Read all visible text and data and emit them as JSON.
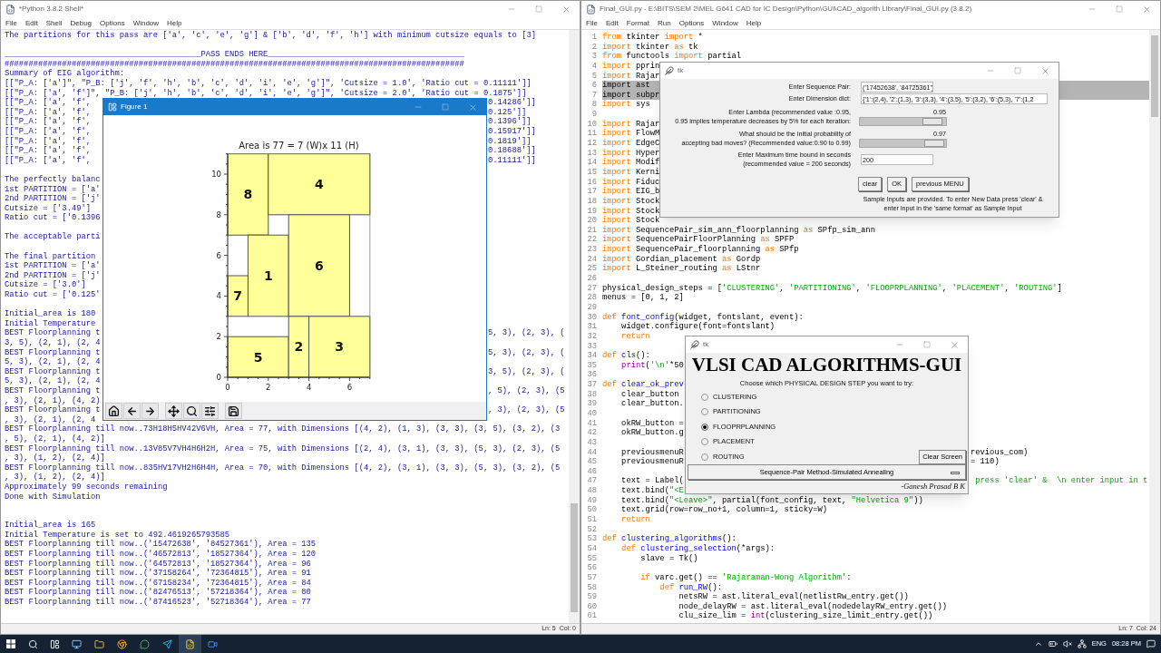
{
  "shell": {
    "title": "*Python 3.8.2 Shell*",
    "menu": [
      "File",
      "Edit",
      "Shell",
      "Debug",
      "Options",
      "Window",
      "Help"
    ],
    "lines": [
      {
        "kind": "text",
        "text": "The partitions for this pass are ['a', 'c', 'e', 'g'] & ['b', 'd', 'f', 'h'] with minimum cutsize equals to [3]"
      },
      {
        "kind": "blank"
      },
      {
        "kind": "text",
        "text": "_________________________________________PASS ENDS HERE_________________________________________"
      },
      {
        "kind": "text",
        "text": "################################################################################################"
      },
      {
        "kind": "text",
        "text": "Summary of EIG algorithm:"
      },
      {
        "kind": "text",
        "text": "[[\"P_A: ['a']\", \"P_B: ['j', 'f', 'h', 'b', 'c', 'd', 'i', 'e', 'g']\", 'Cutsize = 1.0', 'Ratio cut = 0.11111']]"
      },
      {
        "kind": "text",
        "text": "[[\"P_A: ['a', 'f']\", \"P_B: ['j', 'h', 'b', 'c', 'd', 'i', 'e', 'g']\", 'Cutsize = 2.0', 'Ratio cut = 0.1875']]"
      },
      {
        "kind": "split",
        "left": "[[\"P_A: ['a', 'f', ",
        "right": "0.14286']]"
      },
      {
        "kind": "split",
        "left": "[[\"P_A: ['a', 'f', ",
        "right": "0.125']]"
      },
      {
        "kind": "split",
        "left": "[[\"P_A: ['a', 'f', ",
        "right": "0.1396']]"
      },
      {
        "kind": "split",
        "left": "[[\"P_A: ['a', 'f', ",
        "right": "0.15917']]"
      },
      {
        "kind": "split",
        "left": "[[\"P_A: ['a', 'f', ",
        "right": "0.1819']]"
      },
      {
        "kind": "split",
        "left": "[[\"P_A: ['a', 'f', ",
        "right": "0.18688']]"
      },
      {
        "kind": "split",
        "left": "[[\"P_A: ['a', 'f', ",
        "right": "0.11111']]"
      },
      {
        "kind": "blank"
      },
      {
        "kind": "text",
        "text": "The perfectly balanc"
      },
      {
        "kind": "text",
        "text": "1st PARTITION = ['a'"
      },
      {
        "kind": "text",
        "text": "2nd PARTITION = ['j'"
      },
      {
        "kind": "text",
        "text": "Cutsize = ['3.49']"
      },
      {
        "kind": "text",
        "text": "Ratio cut = ['0.1396"
      },
      {
        "kind": "blank"
      },
      {
        "kind": "text",
        "text": "The acceptable parti"
      },
      {
        "kind": "blank"
      },
      {
        "kind": "text",
        "text": "The final partition"
      },
      {
        "kind": "text",
        "text": "1st PARTITION = ['a'"
      },
      {
        "kind": "text",
        "text": "2nd PARTITION = ['j'"
      },
      {
        "kind": "text",
        "text": "Cutsize = ['3.0']"
      },
      {
        "kind": "text",
        "text": "Ratio cut = ['0.125'"
      },
      {
        "kind": "blank"
      },
      {
        "kind": "text",
        "text": "Initial_area is 180"
      },
      {
        "kind": "text",
        "text": "Initial Temperature"
      },
      {
        "kind": "split",
        "left": "BEST Floorplanning t",
        "right": "5, 3), (2, 3), ("
      },
      {
        "kind": "text",
        "text": "3, 5), (2, 1), (2, 4"
      },
      {
        "kind": "split",
        "left": "BEST Floorplanning t",
        "right": "5, 3), (2, 3), ("
      },
      {
        "kind": "text",
        "text": "5, 3), (2, 1), (2, 4"
      },
      {
        "kind": "split",
        "left": "BEST Floorplanning t",
        "right": "3, 5), (2, 3), ("
      },
      {
        "kind": "text",
        "text": "5, 3), (2, 1), (2, 4"
      },
      {
        "kind": "split",
        "left": "BEST Floorplanning t",
        "right": ", 5), (2, 3), (5"
      },
      {
        "kind": "text",
        "text": ", 3), (2, 1), (4, 2)"
      },
      {
        "kind": "split",
        "left": "BEST Floorplanning t",
        "right": ", 3), (2, 3), (5"
      },
      {
        "kind": "text",
        "text": ", 3), (2, 1), (2, 4"
      },
      {
        "kind": "text",
        "text": "BEST Floorplanning till now..73H18H5HV42V6VH, Area = 77, with Dimensions [(4, 2), (1, 3), (3, 3), (3, 5), (3, 2), (3"
      },
      {
        "kind": "text",
        "text": ", 5), (2, 1), (4, 2)]"
      },
      {
        "kind": "text",
        "text": "BEST Floorplanning till now..13V85V7VH4H6H2H, Area = 75, with Dimensions [(2, 4), (3, 1), (3, 3), (5, 3), (2, 3), (5"
      },
      {
        "kind": "text",
        "text": ", 3), (1, 2), (2, 4)]"
      },
      {
        "kind": "text",
        "text": "BEST Floorplanning till now..835HV17VH2H6H4H, Area = 70, with Dimensions [(4, 2), (3, 1), (3, 3), (5, 3), (3, 2), (5"
      },
      {
        "kind": "text",
        "text": ", 3), (1, 2), (2, 4)]"
      },
      {
        "kind": "text",
        "text": "Approximately 99 seconds remaining"
      },
      {
        "kind": "text",
        "text": "Done with Simulation"
      },
      {
        "kind": "blank"
      },
      {
        "kind": "blank"
      },
      {
        "kind": "text",
        "text": "Initial_area is 165"
      },
      {
        "kind": "text",
        "text": "Initial Temperature is set to 492.4619265793585"
      },
      {
        "kind": "text",
        "text": "BEST Floorplanning till now..('15472638', '84527361'), Area = 135"
      },
      {
        "kind": "text",
        "text": "BEST Floorplanning till now..('46572813', '18527364'), Area = 120"
      },
      {
        "kind": "text",
        "text": "BEST Floorplanning till now..('64572813', '18527364'), Area = 96"
      },
      {
        "kind": "text",
        "text": "BEST Floorplanning till now..('37158264', '72364815'), Area = 91"
      },
      {
        "kind": "text",
        "text": "BEST Floorplanning till now..('67158234', '72364815'), Area = 84"
      },
      {
        "kind": "text",
        "text": "BEST Floorplanning till now..('82476513', '57218364'), Area = 80"
      },
      {
        "kind": "text",
        "text": "BEST Floorplanning till now..('87416523', '52718364'), Area = 77"
      }
    ],
    "status": [
      "Ln: 5",
      "Col: 0"
    ]
  },
  "figure": {
    "title": "Figure 1",
    "plot": {
      "title": "Area is 77 = 7 (W)x 11 (H)",
      "xticks": [
        "0",
        "2",
        "4",
        "6"
      ],
      "yticks": [
        "10",
        "8",
        "6",
        "4",
        "2",
        "0"
      ],
      "blocks": [
        {
          "label": "8"
        },
        {
          "label": "4"
        },
        {
          "label": "1"
        },
        {
          "label": "6"
        },
        {
          "label": "7"
        },
        {
          "label": "5"
        },
        {
          "label": "2"
        },
        {
          "label": "3"
        }
      ]
    }
  },
  "editor": {
    "title": "Final_GUI.py - E:\\BITS\\SEM 2\\MEL G641 CAD for IC Design\\Python\\GUI\\CAD_algorith Library\\Final_GUI.py (3.8.2)",
    "menu": [
      "File",
      "Edit",
      "Format",
      "Run",
      "Options",
      "Window",
      "Help"
    ],
    "lines": [
      {
        "n": "1",
        "selected": false,
        "tokens": [
          {
            "kind": "kw",
            "text": "from"
          },
          {
            "kind": "plain",
            "text": " tkinter "
          },
          {
            "kind": "kw",
            "text": "import"
          },
          {
            "kind": "plain",
            "text": " *"
          }
        ]
      },
      {
        "n": "2",
        "selected": false,
        "tokens": [
          {
            "kind": "kw",
            "text": "import"
          },
          {
            "kind": "plain",
            "text": " tkinter "
          },
          {
            "kind": "kw",
            "text": "as"
          },
          {
            "kind": "plain",
            "text": " tk"
          }
        ]
      },
      {
        "n": "3",
        "selected": false,
        "tokens": [
          {
            "kind": "kw",
            "text": "from"
          },
          {
            "kind": "plain",
            "text": " functools "
          },
          {
            "kind": "kw",
            "text": "import"
          },
          {
            "kind": "plain",
            "text": " partial"
          }
        ]
      },
      {
        "n": "4",
        "selected": false,
        "tokens": [
          {
            "kind": "kw",
            "text": "import"
          },
          {
            "kind": "plain",
            "text": " pprin"
          }
        ]
      },
      {
        "n": "5",
        "selected": false,
        "tokens": [
          {
            "kind": "kw",
            "text": "import"
          },
          {
            "kind": "plain",
            "text": " Rajar"
          }
        ]
      },
      {
        "n": "6",
        "selected": true,
        "tokens": [
          {
            "kind": "kw",
            "text": "import"
          },
          {
            "kind": "plain",
            "text": " ast"
          }
        ]
      },
      {
        "n": "7",
        "selected": true,
        "tokens": [
          {
            "kind": "kw",
            "text": "import"
          },
          {
            "kind": "plain",
            "text": " subpr"
          }
        ]
      },
      {
        "n": "8",
        "selected": false,
        "tokens": [
          {
            "kind": "kw",
            "text": "import"
          },
          {
            "kind": "plain",
            "text": " sys"
          }
        ]
      },
      {
        "n": "9",
        "selected": false
      },
      {
        "n": "10",
        "selected": false,
        "tokens": [
          {
            "kind": "kw",
            "text": "import"
          },
          {
            "kind": "plain",
            "text": " Rajar"
          }
        ]
      },
      {
        "n": "11",
        "selected": false,
        "tokens": [
          {
            "kind": "kw",
            "text": "import"
          },
          {
            "kind": "plain",
            "text": " FlowM"
          }
        ]
      },
      {
        "n": "12",
        "selected": false,
        "tokens": [
          {
            "kind": "kw",
            "text": "import"
          },
          {
            "kind": "plain",
            "text": " EdgeC"
          }
        ]
      },
      {
        "n": "13",
        "selected": false,
        "tokens": [
          {
            "kind": "kw",
            "text": "import"
          },
          {
            "kind": "plain",
            "text": " Hyper"
          }
        ]
      },
      {
        "n": "14",
        "selected": false,
        "tokens": [
          {
            "kind": "kw",
            "text": "import"
          },
          {
            "kind": "plain",
            "text": " Modif"
          }
        ]
      },
      {
        "n": "15",
        "selected": false,
        "tokens": [
          {
            "kind": "kw",
            "text": "import"
          },
          {
            "kind": "plain",
            "text": " Kerni"
          }
        ]
      },
      {
        "n": "16",
        "selected": false,
        "tokens": [
          {
            "kind": "kw",
            "text": "import"
          },
          {
            "kind": "plain",
            "text": " Fiduc"
          }
        ]
      },
      {
        "n": "17",
        "selected": false,
        "tokens": [
          {
            "kind": "kw",
            "text": "import"
          },
          {
            "kind": "plain",
            "text": " EIG_b"
          }
        ]
      },
      {
        "n": "18",
        "selected": false,
        "tokens": [
          {
            "kind": "kw",
            "text": "import"
          },
          {
            "kind": "plain",
            "text": " Stock"
          }
        ]
      },
      {
        "n": "19",
        "selected": false,
        "tokens": [
          {
            "kind": "kw",
            "text": "import"
          },
          {
            "kind": "plain",
            "text": " Stock"
          }
        ]
      },
      {
        "n": "20",
        "selected": false,
        "tokens": [
          {
            "kind": "kw",
            "text": "import"
          },
          {
            "kind": "plain",
            "text": " Stock"
          }
        ]
      },
      {
        "n": "21",
        "selected": false,
        "tokens": [
          {
            "kind": "kw",
            "text": "import"
          },
          {
            "kind": "plain",
            "text": " SequencePair_sim_ann_floorplanning "
          },
          {
            "kind": "kw",
            "text": "as"
          },
          {
            "kind": "plain",
            "text": " SPfp_sim_ann"
          }
        ]
      },
      {
        "n": "22",
        "selected": false,
        "tokens": [
          {
            "kind": "kw",
            "text": "import"
          },
          {
            "kind": "plain",
            "text": " SequencePairFloorPlanning "
          },
          {
            "kind": "kw",
            "text": "as"
          },
          {
            "kind": "plain",
            "text": " SPFP"
          }
        ]
      },
      {
        "n": "23",
        "selected": false,
        "tokens": [
          {
            "kind": "kw",
            "text": "import"
          },
          {
            "kind": "plain",
            "text": " SequencePair_floorplanning "
          },
          {
            "kind": "kw",
            "text": "as"
          },
          {
            "kind": "plain",
            "text": " SPfp"
          }
        ]
      },
      {
        "n": "24",
        "selected": false,
        "tokens": [
          {
            "kind": "kw",
            "text": "import"
          },
          {
            "kind": "plain",
            "text": " Gordian_placement "
          },
          {
            "kind": "kw",
            "text": "as"
          },
          {
            "kind": "plain",
            "text": " Gordp"
          }
        ]
      },
      {
        "n": "25",
        "selected": false,
        "tokens": [
          {
            "kind": "kw",
            "text": "import"
          },
          {
            "kind": "plain",
            "text": " L_Steiner_routing "
          },
          {
            "kind": "kw",
            "text": "as"
          },
          {
            "kind": "plain",
            "text": " LStnr"
          }
        ]
      },
      {
        "n": "26",
        "selected": false
      },
      {
        "n": "27",
        "selected": false,
        "tokens": [
          {
            "kind": "plain",
            "text": "physical_design_steps = ["
          },
          {
            "kind": "str",
            "text": "'CLUSTERING'"
          },
          {
            "kind": "plain",
            "text": ", "
          },
          {
            "kind": "str",
            "text": "'PARTITIONING'"
          },
          {
            "kind": "plain",
            "text": ", "
          },
          {
            "kind": "str",
            "text": "'FLOOPRPLANNING'"
          },
          {
            "kind": "plain",
            "text": ", "
          },
          {
            "kind": "str",
            "text": "'PLACEMENT'"
          },
          {
            "kind": "plain",
            "text": ", "
          },
          {
            "kind": "str",
            "text": "'ROUTING'"
          },
          {
            "kind": "plain",
            "text": "]"
          }
        ]
      },
      {
        "n": "28",
        "selected": false,
        "tokens": [
          {
            "kind": "plain",
            "text": "menus = [0, 1, 2]"
          }
        ]
      },
      {
        "n": "29",
        "selected": false
      },
      {
        "n": "30",
        "selected": false,
        "tokens": [
          {
            "kind": "kw",
            "text": "def"
          },
          {
            "kind": "def",
            "text": " font_config"
          },
          {
            "kind": "plain",
            "text": "(widget, fontslant, event):"
          }
        ]
      },
      {
        "n": "31",
        "selected": false,
        "tokens": [
          {
            "kind": "plain",
            "text": "    widget.configure(font=fontslant)"
          }
        ]
      },
      {
        "n": "32",
        "selected": false,
        "tokens": [
          {
            "kind": "kw",
            "text": "    return"
          }
        ]
      },
      {
        "n": "33",
        "selected": false
      },
      {
        "n": "34",
        "selected": false,
        "tokens": [
          {
            "kind": "kw",
            "text": "def"
          },
          {
            "kind": "def",
            "text": " cls"
          },
          {
            "kind": "plain",
            "text": "():"
          }
        ]
      },
      {
        "n": "35",
        "selected": false,
        "tokens": [
          {
            "kind": "bi",
            "text": "    print"
          },
          {
            "kind": "plain",
            "text": "("
          },
          {
            "kind": "str",
            "text": "'\\n'"
          },
          {
            "kind": "plain",
            "text": "*50"
          }
        ]
      },
      {
        "n": "36",
        "selected": false
      },
      {
        "n": "37",
        "selected": false,
        "tokens": [
          {
            "kind": "kw",
            "text": "def"
          },
          {
            "kind": "def",
            "text": " clear_ok_prev"
          }
        ]
      },
      {
        "n": "38",
        "selected": false,
        "tokens": [
          {
            "kind": "plain",
            "text": "    clear_button"
          }
        ]
      },
      {
        "n": "39",
        "selected": false,
        "tokens": [
          {
            "kind": "plain",
            "text": "    clear_button."
          }
        ]
      },
      {
        "n": "40",
        "selected": false
      },
      {
        "n": "41",
        "selected": false,
        "tokens": [
          {
            "kind": "plain",
            "text": "    okRW_button ="
          }
        ]
      },
      {
        "n": "42",
        "selected": false,
        "tokens": [
          {
            "kind": "plain",
            "text": "    okRW_button.g"
          }
        ]
      },
      {
        "n": "43",
        "selected": false
      },
      {
        "n": "44",
        "selected": false,
        "tokens": [
          {
            "kind": "plain",
            "text": "    previousmenuR"
          }
        ],
        "right": [
          {
            "kind": "plain",
            "text": "revious_com)"
          }
        ]
      },
      {
        "n": "45",
        "selected": false,
        "tokens": [
          {
            "kind": "plain",
            "text": "    previousmenuR"
          }
        ],
        "right": [
          {
            "kind": "plain",
            "text": "= 110)"
          }
        ]
      },
      {
        "n": "46",
        "selected": false
      },
      {
        "n": "47",
        "selected": false,
        "tokens": [
          {
            "kind": "plain",
            "text": "    text = Label("
          }
        ],
        "right": [
          {
            "kind": "str",
            "text": " press 'clear' &  \\n enter input in t"
          }
        ]
      },
      {
        "n": "48",
        "selected": false,
        "tokens": [
          {
            "kind": "plain",
            "text": "    text.bind("
          },
          {
            "kind": "str",
            "text": "\"<E"
          }
        ]
      },
      {
        "n": "49",
        "selected": false,
        "tokens": [
          {
            "kind": "plain",
            "text": "    text.bind("
          },
          {
            "kind": "str",
            "text": "\"<Leave>\""
          },
          {
            "kind": "plain",
            "text": ", partial(font_config, text, "
          },
          {
            "kind": "str",
            "text": "\"Helvetica 9\""
          },
          {
            "kind": "plain",
            "text": "))"
          }
        ]
      },
      {
        "n": "50",
        "selected": false,
        "tokens": [
          {
            "kind": "plain",
            "text": "    text.grid(row=row_no+1, column=1, sticky=W)"
          }
        ]
      },
      {
        "n": "51",
        "selected": false,
        "tokens": [
          {
            "kind": "kw",
            "text": "    return"
          }
        ]
      },
      {
        "n": "52",
        "selected": false
      },
      {
        "n": "53",
        "selected": false,
        "tokens": [
          {
            "kind": "kw",
            "text": "def"
          },
          {
            "kind": "def",
            "text": " clustering_algorithms"
          },
          {
            "kind": "plain",
            "text": "():"
          }
        ]
      },
      {
        "n": "54",
        "selected": false,
        "tokens": [
          {
            "kind": "kw",
            "text": "    def"
          },
          {
            "kind": "def",
            "text": " clustering_selection"
          },
          {
            "kind": "plain",
            "text": "(*args):"
          }
        ]
      },
      {
        "n": "55",
        "selected": false,
        "tokens": [
          {
            "kind": "plain",
            "text": "        slave = Tk()"
          }
        ]
      },
      {
        "n": "56",
        "selected": false
      },
      {
        "n": "57",
        "selected": false,
        "tokens": [
          {
            "kind": "kw",
            "text": "        if"
          },
          {
            "kind": "plain",
            "text": " varc.get() == "
          },
          {
            "kind": "str",
            "text": "'Rajaraman-Wong Algorithm'"
          },
          {
            "kind": "plain",
            "text": ":"
          }
        ]
      },
      {
        "n": "58",
        "selected": false,
        "tokens": [
          {
            "kind": "kw",
            "text": "            def"
          },
          {
            "kind": "def",
            "text": " run_RW"
          },
          {
            "kind": "plain",
            "text": "():"
          }
        ]
      },
      {
        "n": "59",
        "selected": false,
        "tokens": [
          {
            "kind": "plain",
            "text": "                netsRW = ast.literal_eval(netlistRw_entry.get())"
          }
        ]
      },
      {
        "n": "60",
        "selected": false,
        "tokens": [
          {
            "kind": "plain",
            "text": "                node_delayRW = ast.literal_eval(nodedelayRW_entry.get())"
          }
        ]
      },
      {
        "n": "61",
        "selected": false,
        "tokens": [
          {
            "kind": "plain",
            "text": "                clu_size_lim = "
          },
          {
            "kind": "bi",
            "text": "int"
          },
          {
            "kind": "plain",
            "text": "(clustering_size_limit_entry.get())"
          }
        ]
      }
    ],
    "status": [
      "Ln: 7",
      "Col: 24"
    ]
  },
  "input_dialog": {
    "title": "tk",
    "rows": [
      {
        "kind": "entry",
        "label": [
          "Enter Sequence Pair:"
        ],
        "value": "('17452638', '84725361')"
      },
      {
        "kind": "entry",
        "label": [
          "Enter Dimension dict:"
        ],
        "value": "{'1':(2,4), '2':(1,3), '3':(3,3), '4':(3,5), '5':(3,2), '6':(5,3), '7':(1,2"
      },
      {
        "kind": "slider",
        "label": [
          "Enter Lambda (recommended value :0.95,",
          "0.95 implies temperature decreases by 5% for each iteration:"
        ],
        "reading": "0.95",
        "level": 0.95
      },
      {
        "kind": "slider",
        "label": [
          "What should be the initial probability of",
          "accepting bad moves? (Recommended value:0.90 to 0.99)"
        ],
        "reading": "0.97",
        "level": 0.97
      },
      {
        "kind": "entry",
        "label": [
          "Enter Maximum time bound in seconds",
          "(recommended value = 200 seconds)"
        ],
        "value": "200"
      }
    ],
    "buttons": [
      "clear",
      "OK",
      "previous MENU"
    ],
    "note": [
      "Sample Inputs are provided. To enter New Data press 'clear' &",
      "enter input in the 'same format' as Sample Input"
    ]
  },
  "menu_dialog": {
    "title": "tk",
    "heading": "VLSI CAD ALGORITHMS-GUI",
    "prompt": "Choose which PHYSICAL DESIGN STEP you want to try:",
    "options": [
      {
        "label": "CLUSTERING",
        "selected": false
      },
      {
        "label": "PARTITIONING",
        "selected": false
      },
      {
        "label": "FLOOPRPLANNING",
        "selected": true
      },
      {
        "label": "PLACEMENT",
        "selected": false
      },
      {
        "label": "ROUTING",
        "selected": false
      }
    ],
    "clear_button": "Clear Screen",
    "method": "Sequence-Pair Method-Simulated Annealing",
    "author": "-Ganesh Prasad B K"
  },
  "taskbar": {
    "language": "ENG",
    "time": "08:28 PM"
  }
}
